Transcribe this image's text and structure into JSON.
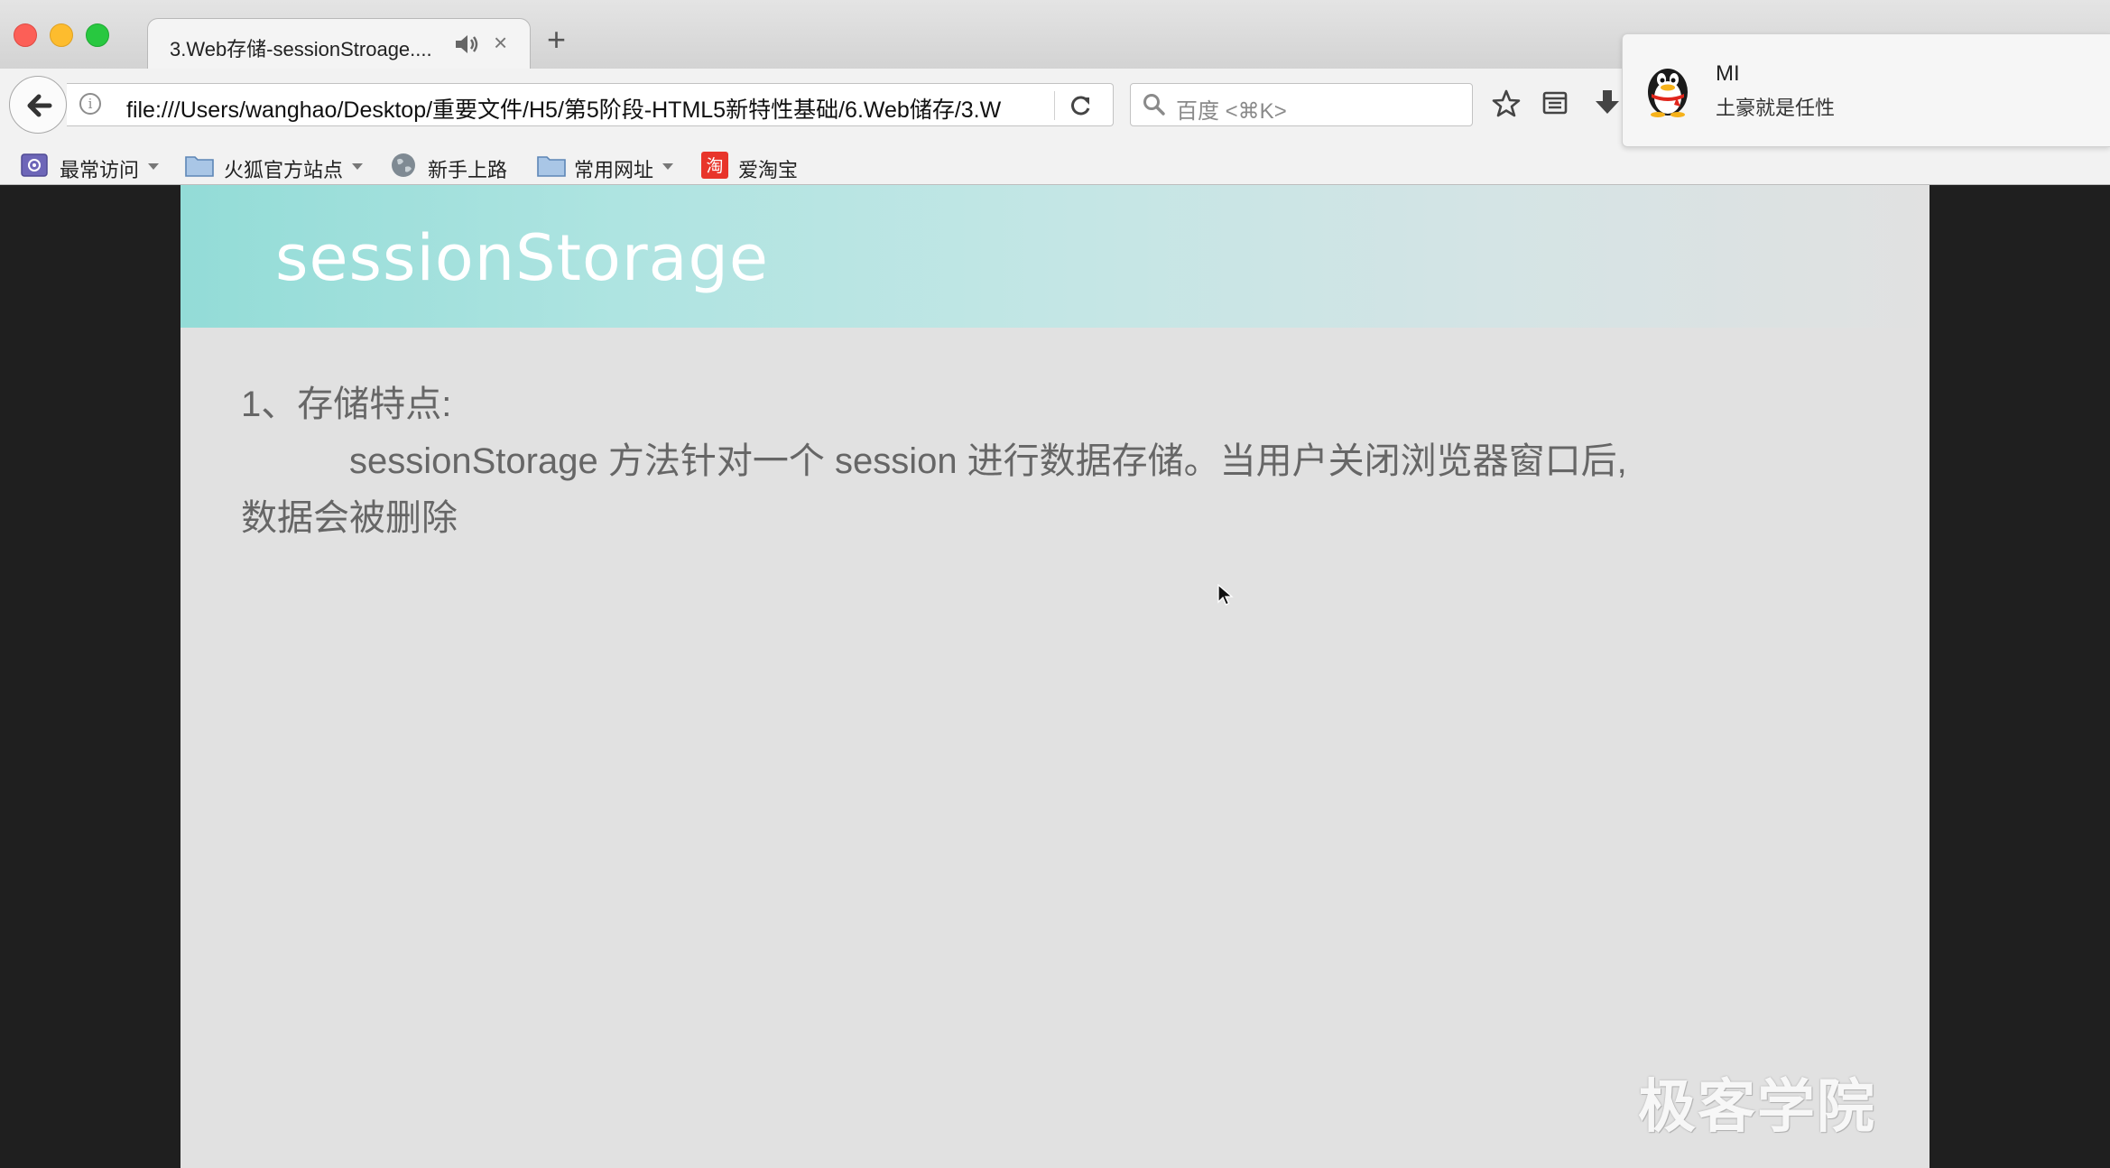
{
  "tab": {
    "title": "3.Web存储-sessionStroage...."
  },
  "navbar": {
    "url": "file:///Users/wanghao/Desktop/重要文件/H5/第5阶段-HTML5新特性基础/6.Web储存/3.W",
    "search_placeholder": "百度 <⌘K>"
  },
  "bookmarks": [
    {
      "label": "最常访问",
      "icon": "most-visited-icon",
      "has_menu": true
    },
    {
      "label": "火狐官方站点",
      "icon": "folder-icon",
      "has_menu": true
    },
    {
      "label": "新手上路",
      "icon": "globe-icon",
      "has_menu": false
    },
    {
      "label": "常用网址",
      "icon": "folder-icon",
      "has_menu": true
    },
    {
      "label": "爱淘宝",
      "icon": "taobao-icon",
      "has_menu": false,
      "icon_text": "淘"
    }
  ],
  "notification": {
    "sender": "MI",
    "message": "土豪就是任性",
    "icon": "qq-penguin-icon"
  },
  "slide": {
    "title": "sessionStorage",
    "heading": "1、存储特点:",
    "body_line1": "sessionStorage 方法针对一个 session 进行数据存储。当用户关闭浏览器窗口后,",
    "body_line2": "数据会被删除",
    "watermark": "极客学院"
  },
  "colors": {
    "header_gradient_start": "#93dcd7",
    "slide_background": "#e1e1e1",
    "outer_background": "#1f1f1f"
  }
}
